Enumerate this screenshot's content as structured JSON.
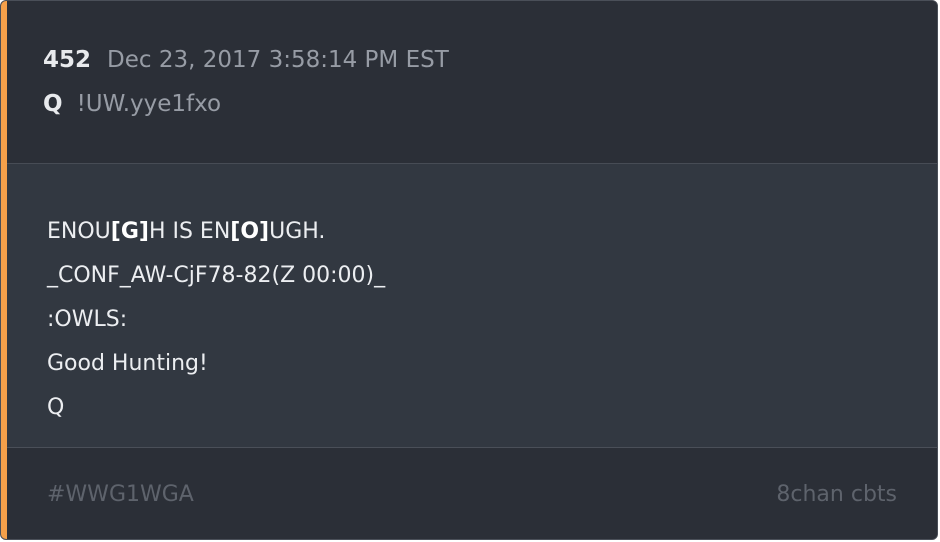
{
  "post": {
    "number": "452",
    "timestamp": "Dec 23, 2017 3:58:14 PM EST",
    "author": "Q",
    "tripcode": "!UW.yye1fxo"
  },
  "message": {
    "line1": {
      "p1": "ENOU",
      "b1": "[G]",
      "p2": "H IS EN",
      "b2": "[O]",
      "p3": "UGH."
    },
    "line2": "_CONF_AW-CjF78-82(Z 00:00)_",
    "line3": ":OWLS:",
    "line4": "Good Hunting!",
    "line5": "Q"
  },
  "footer": {
    "hashtag": "#WWG1WGA",
    "source": "8chan cbts"
  },
  "colors": {
    "accent": "#f5a04a",
    "header_bg": "#2b2f37",
    "body_bg": "#323841"
  }
}
